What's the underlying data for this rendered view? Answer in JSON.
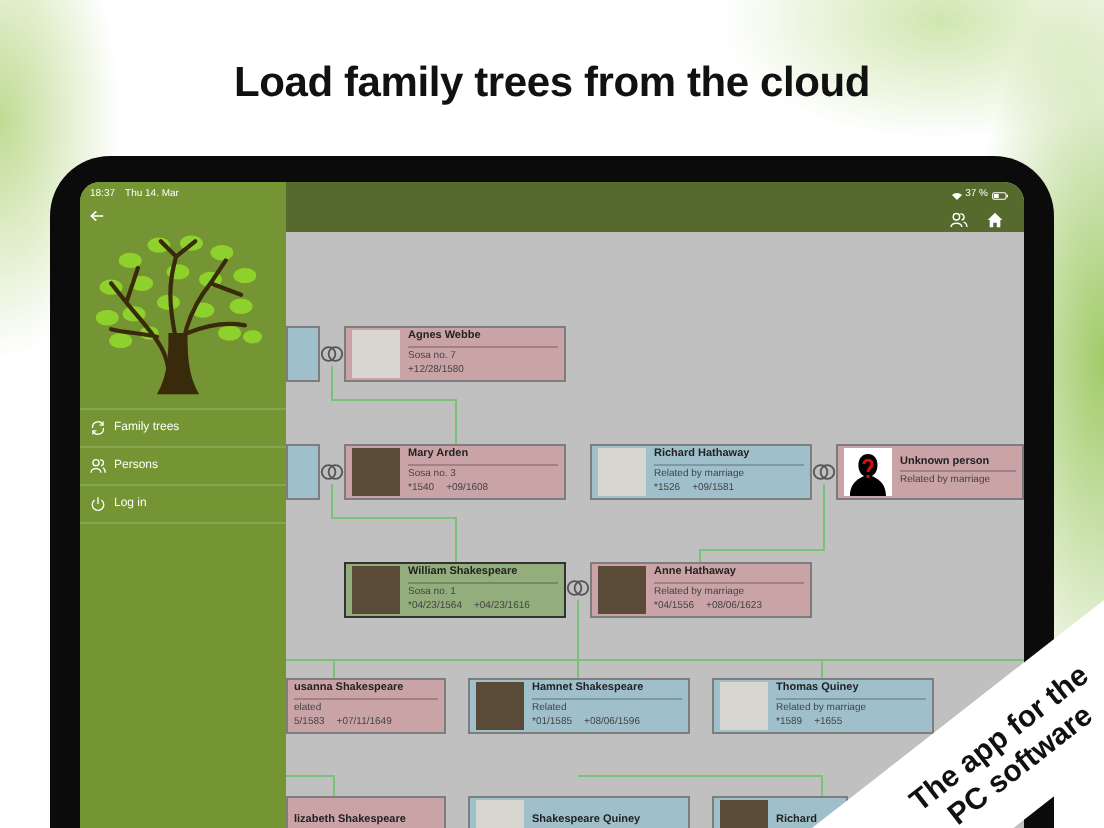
{
  "headline": "Load family trees from the cloud",
  "status_bar": {
    "time": "18:37",
    "date": "Thu 14. Mar",
    "battery": "37 %"
  },
  "sidebar": {
    "items": [
      {
        "label": "Family trees"
      },
      {
        "label": "Persons"
      },
      {
        "label": "Log in"
      }
    ]
  },
  "tree": {
    "persons": [
      {
        "color": "#9fbfcb",
        "selected": false
      },
      {
        "name": "Agnes Webbe",
        "line_2": "Sosa no. 7",
        "death": "+12/28/1580",
        "color": "#c9a3a6",
        "selected": false,
        "kind": "document"
      },
      {
        "color": "#9fbfcb",
        "selected": false
      },
      {
        "name": "Mary Arden",
        "line_2": "Sosa no. 3",
        "birth": "*1540",
        "death": "+09/1608",
        "color": "#c9a3a6",
        "selected": false,
        "kind": "portrait"
      },
      {
        "name": "Richard Hathaway",
        "line_2": "Related by marriage",
        "birth": "*1526",
        "death": "+09/1581",
        "color": "#9fbfcb",
        "selected": false,
        "kind": "document"
      },
      {
        "name": "Unknown person",
        "line_2": "Related by marriage",
        "color": "#c9a3a6",
        "selected": false,
        "kind": "unknown"
      },
      {
        "name": "William Shakespeare",
        "line_2": "Sosa no. 1",
        "birth": "*04/23/1564",
        "death": "+04/23/1616",
        "color": "#93ad7c",
        "selected": true,
        "kind": "portrait"
      },
      {
        "name": "Anne Hathaway",
        "line_2": "Related by marriage",
        "birth": "*04/1556",
        "death": "+08/06/1623",
        "color": "#c9a3a6",
        "selected": false,
        "kind": "portrait"
      },
      {
        "name": "usanna Shakespeare",
        "line_2": "elated",
        "birth": "5/1583",
        "death": "+07/11/1649",
        "color": "#c9a3a6",
        "selected": false
      },
      {
        "name": "Hamnet Shakespeare",
        "line_2": "Related",
        "birth": "*01/1585",
        "death": "+08/06/1596",
        "color": "#9fbfcb",
        "selected": false,
        "kind": "portrait"
      },
      {
        "name": "Thomas Quiney",
        "line_2": "Related by marriage",
        "birth": "*1589",
        "death": "+1655",
        "color": "#9fbfcb",
        "selected": false,
        "kind": "document"
      },
      {
        "name": "lizabeth Shakespeare",
        "color": "#c9a3a6",
        "selected": false
      },
      {
        "name": "Shakespeare Quiney",
        "color": "#9fbfcb",
        "selected": false,
        "kind": "document"
      },
      {
        "name": "Richard",
        "color": "#9fbfcb",
        "selected": false,
        "kind": "portrait"
      }
    ]
  },
  "banner": "The app for the PC software"
}
